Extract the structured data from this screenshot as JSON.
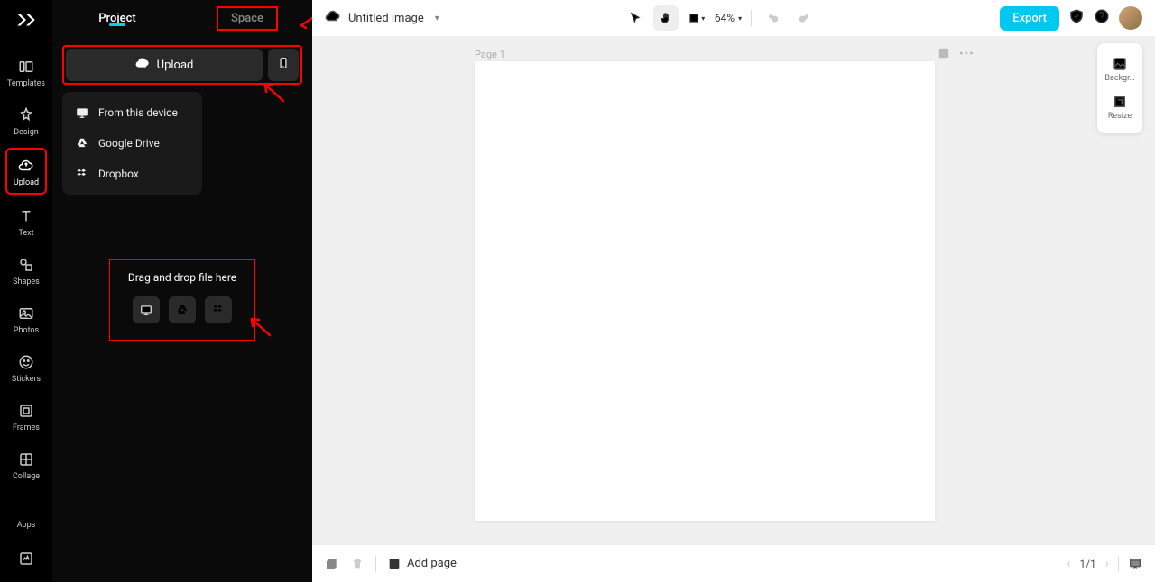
{
  "rail": {
    "items": [
      {
        "label": "Templates"
      },
      {
        "label": "Design"
      },
      {
        "label": "Upload"
      },
      {
        "label": "Text"
      },
      {
        "label": "Shapes"
      },
      {
        "label": "Photos"
      },
      {
        "label": "Stickers"
      },
      {
        "label": "Frames"
      },
      {
        "label": "Collage"
      },
      {
        "label": "Apps"
      }
    ]
  },
  "panel": {
    "tabs": {
      "project": "Project",
      "space": "Space"
    },
    "upload_label": "Upload",
    "dropdown": {
      "device": "From this device",
      "gdrive": "Google Drive",
      "dropbox": "Dropbox"
    },
    "dropzone_text": "Drag and drop file here"
  },
  "topbar": {
    "title": "Untitled image",
    "zoom": "64%",
    "export": "Export"
  },
  "canvas": {
    "page_label": "Page 1"
  },
  "right_tools": {
    "background": "Backgr…",
    "resize": "Resize"
  },
  "bottombar": {
    "add_page": "Add page",
    "pager": "1/1"
  }
}
